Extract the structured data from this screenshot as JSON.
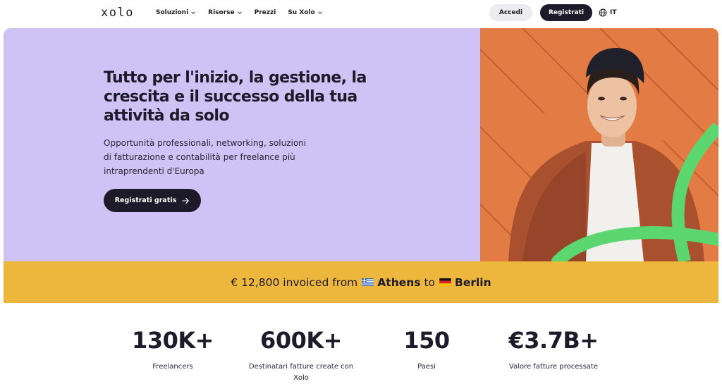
{
  "header": {
    "logo": "xolo",
    "menu": [
      {
        "label": "Soluzioni",
        "has_dropdown": true
      },
      {
        "label": "Risorse",
        "has_dropdown": true
      },
      {
        "label": "Prezzi",
        "has_dropdown": false
      },
      {
        "label": "Su Xolo",
        "has_dropdown": true
      }
    ],
    "login_label": "Accedi",
    "signup_label": "Registrati",
    "language": "IT",
    "language_icon": "globe-icon"
  },
  "hero": {
    "title": "Tutto per l'inizio, la gestione, la crescita e il successo della tua attività da solo",
    "subtitle": "Opportunità professionali, networking, soluzioni di fatturazione e contabilità per freelance più intraprendenti d'Europa",
    "cta_label": "Registrati gratis",
    "cta_icon": "arrow-right-icon",
    "background_color": "#cfc2f5"
  },
  "ticker": {
    "amount_text": "€ 12,800 invoiced from",
    "from_city": "Athens",
    "from_flag": "greece-flag-icon",
    "connector": "to",
    "to_city": "Berlin",
    "to_flag": "germany-flag-icon",
    "background_color": "#edb63d"
  },
  "stats": [
    {
      "value": "130K+",
      "label": "Freelancers"
    },
    {
      "value": "600K+",
      "label": "Destinatari fatture create con Xolo"
    },
    {
      "value": "150",
      "label": "Paesi"
    },
    {
      "value": "€3.7B+",
      "label": "Valore fatture processate"
    }
  ],
  "colors": {
    "dark": "#1d1a2a",
    "accent_green": "#5cd66e",
    "photo_orange": "#e37b45"
  }
}
